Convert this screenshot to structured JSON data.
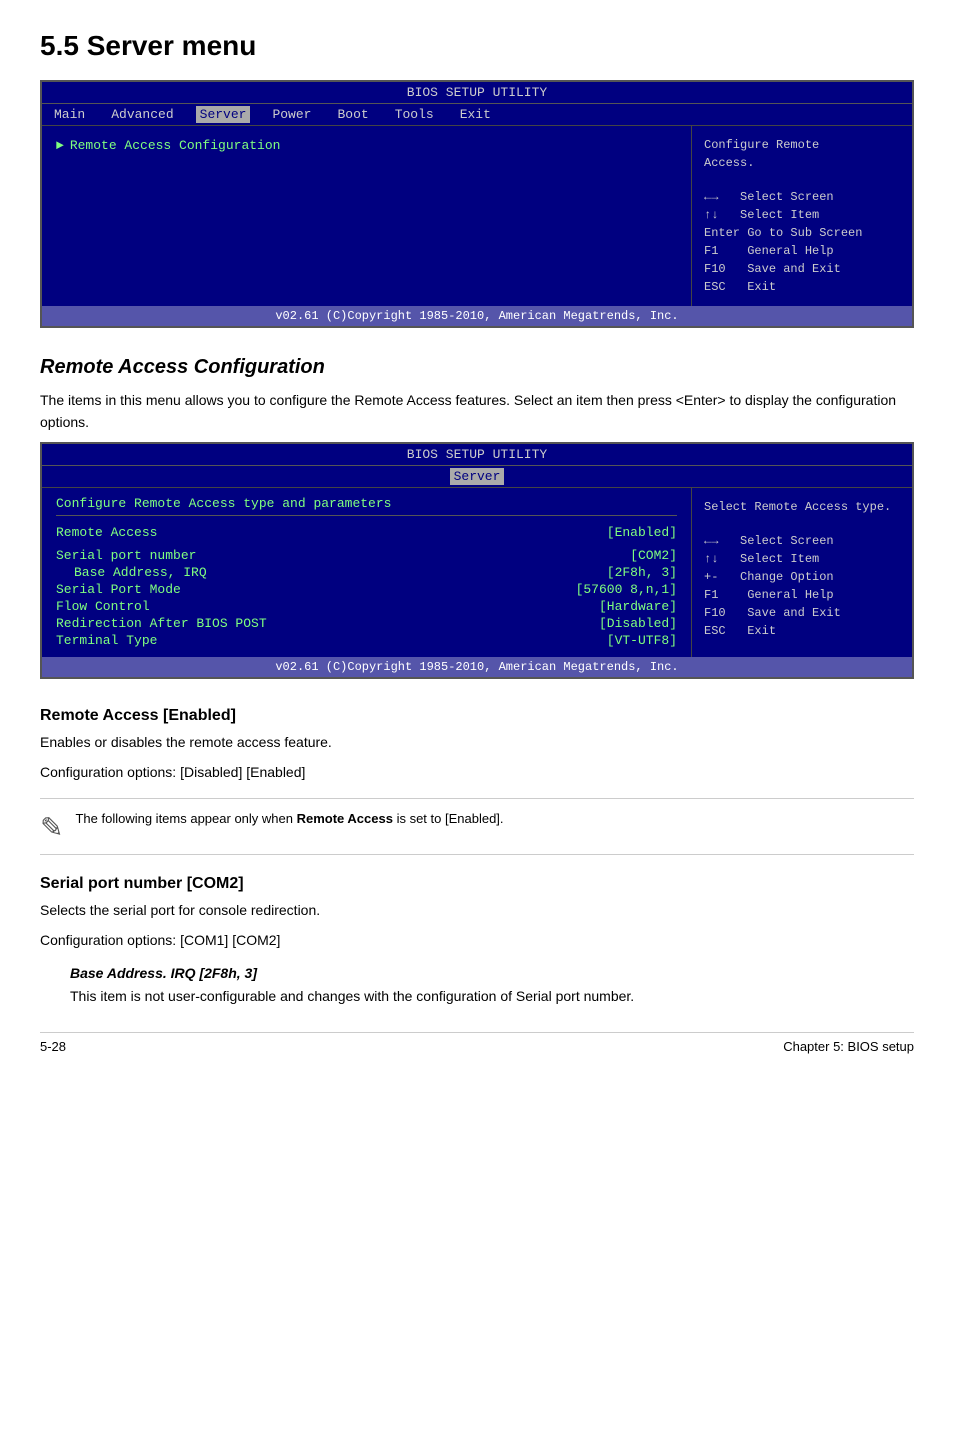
{
  "page": {
    "title": "5.5  Server menu"
  },
  "bios1": {
    "title": "BIOS SETUP UTILITY",
    "menu_items": [
      "Main",
      "Advanced",
      "Server",
      "Power",
      "Boot",
      "Tools",
      "Exit"
    ],
    "active_item": "Server",
    "main_item": "Remote Access Configuration",
    "side_help": "Configure Remote\nAccess.",
    "keys": [
      {
        "key": "←→",
        "action": "Select Screen"
      },
      {
        "key": "↑↓",
        "action": "Select Item"
      },
      {
        "key": "Enter",
        "action": "Go to Sub Screen"
      },
      {
        "key": "F1",
        "action": "General Help"
      },
      {
        "key": "F10",
        "action": "Save and Exit"
      },
      {
        "key": "ESC",
        "action": "Exit"
      }
    ],
    "footer": "v02.61  (C)Copyright 1985-2010, American Megatrends, Inc."
  },
  "section1": {
    "title": "Remote Access Configuration",
    "description": "The items in this menu allows you to configure the Remote Access features. Select an item then press <Enter> to display the configuration options."
  },
  "bios2": {
    "title": "BIOS SETUP UTILITY",
    "submenu_label": "Server",
    "config_section_title": "Configure Remote Access type and parameters",
    "side_help_title": "Select Remote Access type.",
    "rows": [
      {
        "label": "Remote Access",
        "value": "[Enabled]",
        "indent": 0
      },
      {
        "label": "",
        "value": "",
        "indent": 0
      },
      {
        "label": "Serial port number",
        "value": "[COM2]",
        "indent": 0
      },
      {
        "label": "   Base Address, IRQ",
        "value": "[2F8h, 3]",
        "indent": 1
      },
      {
        "label": "Serial Port Mode",
        "value": "[57600 8,n,1]",
        "indent": 0
      },
      {
        "label": "Flow Control",
        "value": "[Hardware]",
        "indent": 0
      },
      {
        "label": "Redirection After BIOS POST",
        "value": "[Disabled]",
        "indent": 0
      },
      {
        "label": "Terminal Type",
        "value": "[VT-UTF8]",
        "indent": 0
      }
    ],
    "keys": [
      {
        "key": "←→",
        "action": "Select Screen"
      },
      {
        "key": "↑↓",
        "action": "Select Item"
      },
      {
        "key": "+-",
        "action": "Change Option"
      },
      {
        "key": "F1",
        "action": "General Help"
      },
      {
        "key": "F10",
        "action": "Save and Exit"
      },
      {
        "key": "ESC",
        "action": "Exit"
      }
    ],
    "footer": "v02.61  (C)Copyright 1985-2010, American Megatrends, Inc."
  },
  "section2": {
    "title": "Remote Access [Enabled]",
    "description1": "Enables or disables the remote access feature.",
    "description2": "Configuration options: [Disabled] [Enabled]",
    "note": "The following items appear only when Remote Access is set to [Enabled].",
    "note_bold": "Remote Access"
  },
  "section3": {
    "title": "Serial port number [COM2]",
    "description1": "Selects the serial port for console redirection.",
    "description2": "Configuration options: [COM1] [COM2]",
    "sub_title": "Base Address. IRQ [2F8h, 3]",
    "sub_desc": "This item is not user-configurable and changes with the configuration of Serial port number."
  },
  "footer": {
    "left": "5-28",
    "right": "Chapter 5: BIOS setup"
  }
}
